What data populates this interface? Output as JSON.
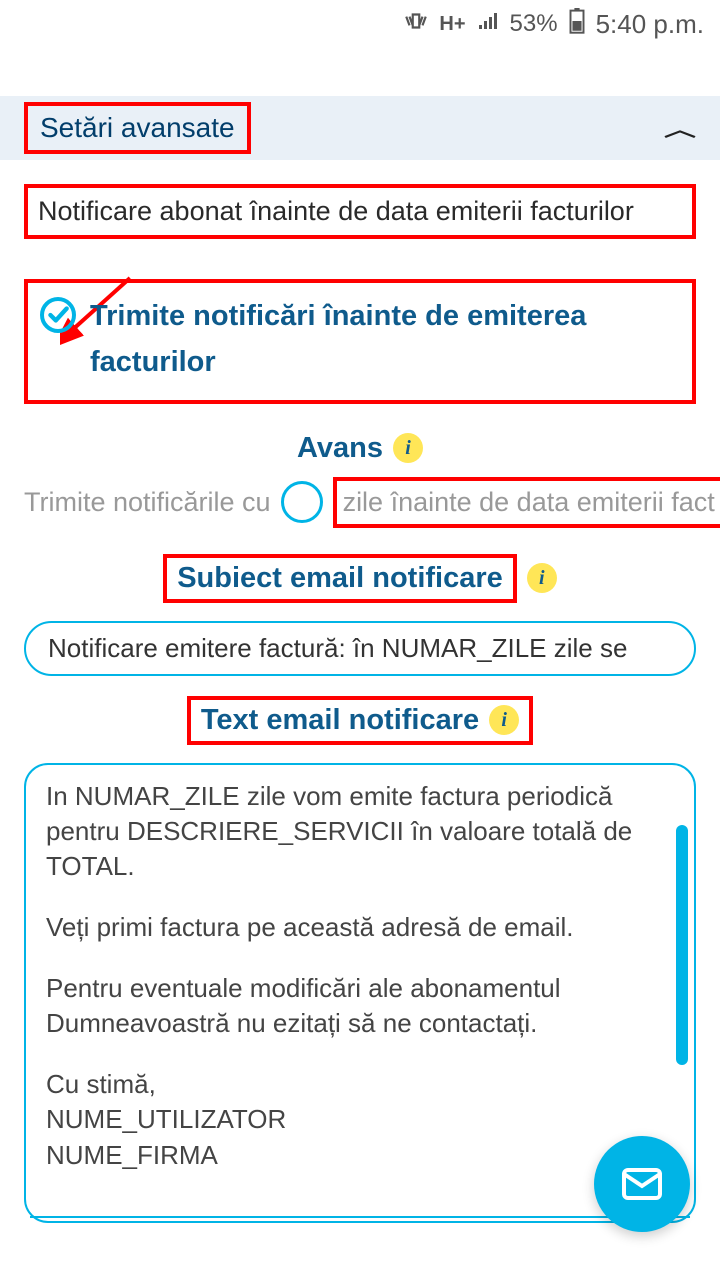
{
  "status": {
    "network": "H+",
    "battery_pct": "53%",
    "time": "5:40 p.m."
  },
  "accordion": {
    "title": "Setări avansate"
  },
  "section": {
    "title": "Notificare abonat înainte de data emiterii facturilor"
  },
  "checkbox": {
    "label": "Trimite notificări înainte de emiterea facturilor"
  },
  "advance": {
    "label": "Avans",
    "left_text": "Trimite notificările cu",
    "right_text": "zile înainte de data emiterii fact"
  },
  "email_subject": {
    "label": "Subiect email notificare",
    "value": "Notificare emitere factură: în NUMAR_ZILE zile se"
  },
  "email_text": {
    "label": "Text email notificare",
    "p1": "In NUMAR_ZILE zile vom emite factura periodică pentru DESCRIERE_SERVICII în valoare totală de TOTAL.",
    "p2": "Veți primi factura pe această adresă de email.",
    "p3": "Pentru eventuale modificări ale abonamentul Dumneavoastră nu ezitați să ne contactați.",
    "p4": "Cu stimă,\nNUME_UTILIZATOR\nNUME_FIRMA"
  }
}
